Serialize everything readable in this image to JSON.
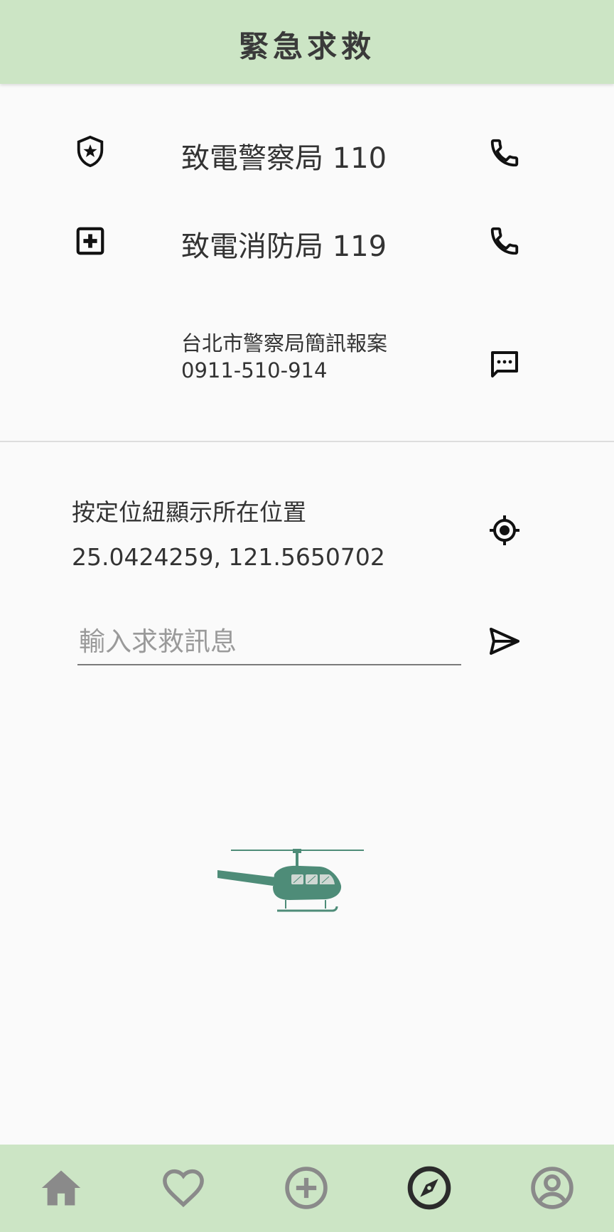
{
  "header": {
    "title": "緊急求救"
  },
  "contacts": [
    {
      "label": "致電警察局 110",
      "lead_icon": "police-shield-icon",
      "action_icon": "phone-icon"
    },
    {
      "label": "致電消防局 119",
      "lead_icon": "medical-plus-icon",
      "action_icon": "phone-icon"
    }
  ],
  "sms": {
    "line1": "台北市警察局簡訊報案",
    "line2": "0911-510-914",
    "action_icon": "sms-icon"
  },
  "location": {
    "prompt": "按定位紐顯示所在位置",
    "coords": "25.0424259, 121.5650702",
    "action_icon": "my-location-icon"
  },
  "message": {
    "placeholder": "輸入求救訊息",
    "value": "",
    "send_icon": "send-icon"
  },
  "illustration": "helicopter-icon",
  "bottom_nav": [
    {
      "icon": "home-icon",
      "active": false
    },
    {
      "icon": "heart-icon",
      "active": false
    },
    {
      "icon": "add-circle-icon",
      "active": false
    },
    {
      "icon": "compass-icon",
      "active": true
    },
    {
      "icon": "account-circle-icon",
      "active": false
    }
  ],
  "colors": {
    "bar_background": "#cce5c5",
    "page_background": "#fafafa",
    "nav_inactive": "#8a8a8a",
    "nav_active": "#2b2b2b",
    "helicopter": "#4e8c78"
  }
}
